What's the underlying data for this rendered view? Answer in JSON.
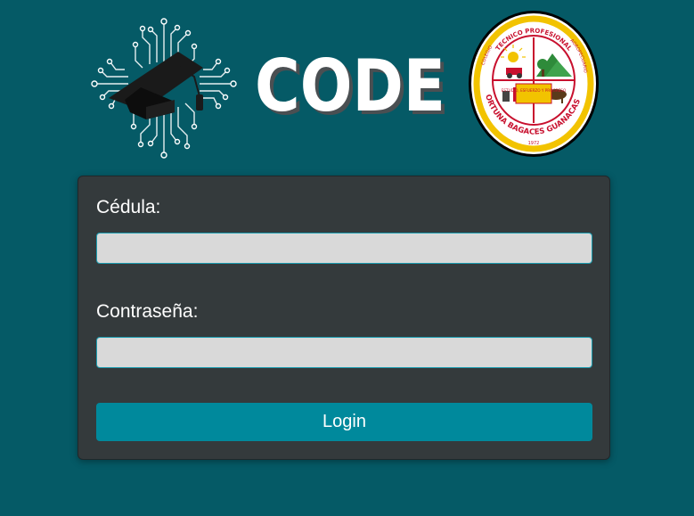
{
  "colors": {
    "page_background": "#055a66",
    "card_background": "#343a3c",
    "input_background": "#d9d9d9",
    "input_border": "#1b9db0",
    "button_background": "#00899c",
    "label_text": "#ffffff"
  },
  "header": {
    "logo_icon": "graduation-cap-circuit-icon",
    "wordmark": "CODE",
    "seal": {
      "icon": "school-seal-icon",
      "top_text": "TECNICO PROFESIONAL",
      "left_text": "COLEGIO",
      "right_text": "AGROPECUARIO",
      "center_text": "ESTUDIO, ESFUERZO Y PROGRESO",
      "bottom_text": "FORTUNA BAGACES GUANACASTE",
      "year": "1972"
    }
  },
  "form": {
    "cedula_label": "Cédula:",
    "cedula_value": "",
    "cedula_placeholder": "",
    "password_label": "Contraseña:",
    "password_value": "",
    "password_placeholder": "",
    "login_label": "Login"
  }
}
